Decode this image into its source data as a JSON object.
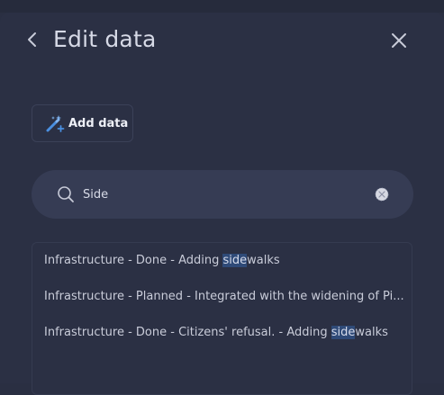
{
  "header": {
    "title": "Edit data"
  },
  "toolbar": {
    "add_label": "Add data"
  },
  "search": {
    "value": "Side",
    "placeholder": ""
  },
  "results": [
    {
      "before": "Infrastructure - Done - Adding ",
      "match": "side",
      "after": "walks"
    },
    {
      "before": "Infrastructure - Planned - Integrated with the widening of Pi...",
      "match": "",
      "after": ""
    },
    {
      "before": "Infrastructure - Done - Citizens' refusal. - Adding ",
      "match": "side",
      "after": "walks"
    }
  ],
  "icons": {
    "back": "chevron-left-icon",
    "close": "close-icon",
    "add": "magic-wand-plus-icon",
    "search": "search-icon",
    "clear": "clear-icon"
  },
  "colors": {
    "background": "#2b3044",
    "search_bg": "#363c54",
    "highlight": "#2f4a78",
    "accent": "#4a8fe0"
  }
}
